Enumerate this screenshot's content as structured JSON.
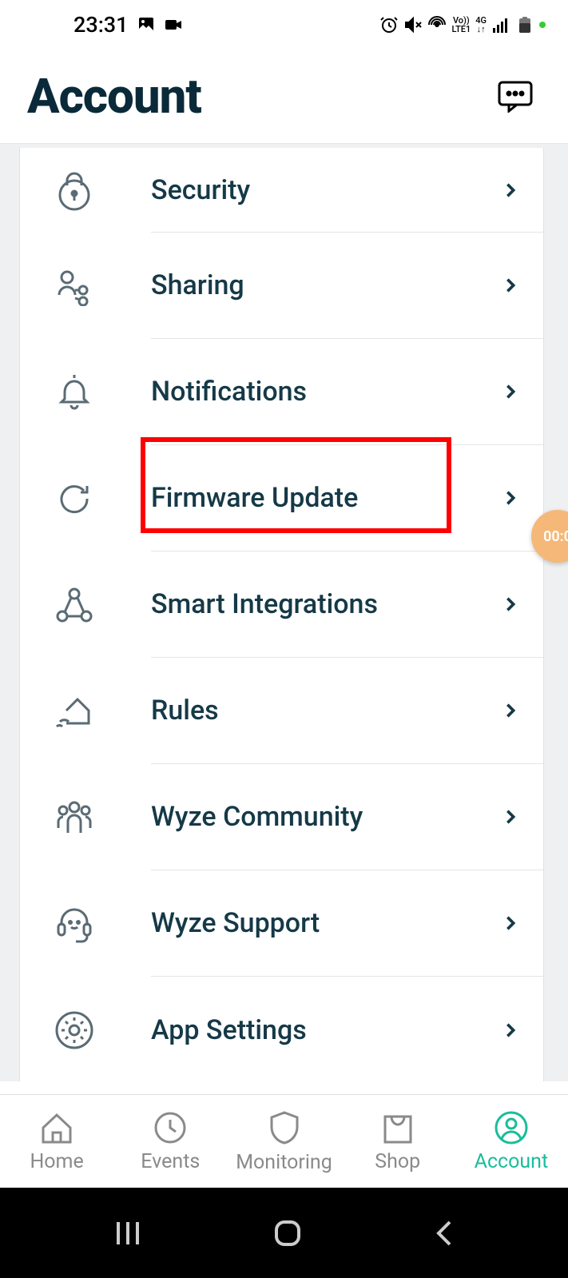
{
  "status": {
    "time": "23:31"
  },
  "header": {
    "title": "Account"
  },
  "menu": [
    {
      "id": "security",
      "label": "Security",
      "icon": "lock"
    },
    {
      "id": "sharing",
      "label": "Sharing",
      "icon": "share"
    },
    {
      "id": "notifications",
      "label": "Notifications",
      "icon": "bell"
    },
    {
      "id": "firmware",
      "label": "Firmware Update",
      "icon": "refresh",
      "highlighted": true
    },
    {
      "id": "integrations",
      "label": "Smart Integrations",
      "icon": "triangle"
    },
    {
      "id": "rules",
      "label": "Rules",
      "icon": "home-signal"
    },
    {
      "id": "community",
      "label": "Wyze Community",
      "icon": "people"
    },
    {
      "id": "support",
      "label": "Wyze Support",
      "icon": "headset"
    },
    {
      "id": "appsettings",
      "label": "App Settings",
      "icon": "gear"
    }
  ],
  "tabs": [
    {
      "id": "home",
      "label": "Home"
    },
    {
      "id": "events",
      "label": "Events"
    },
    {
      "id": "monitoring",
      "label": "Monitoring"
    },
    {
      "id": "shop",
      "label": "Shop"
    },
    {
      "id": "account",
      "label": "Account",
      "active": true
    }
  ],
  "floating": {
    "timer": "00:0"
  }
}
